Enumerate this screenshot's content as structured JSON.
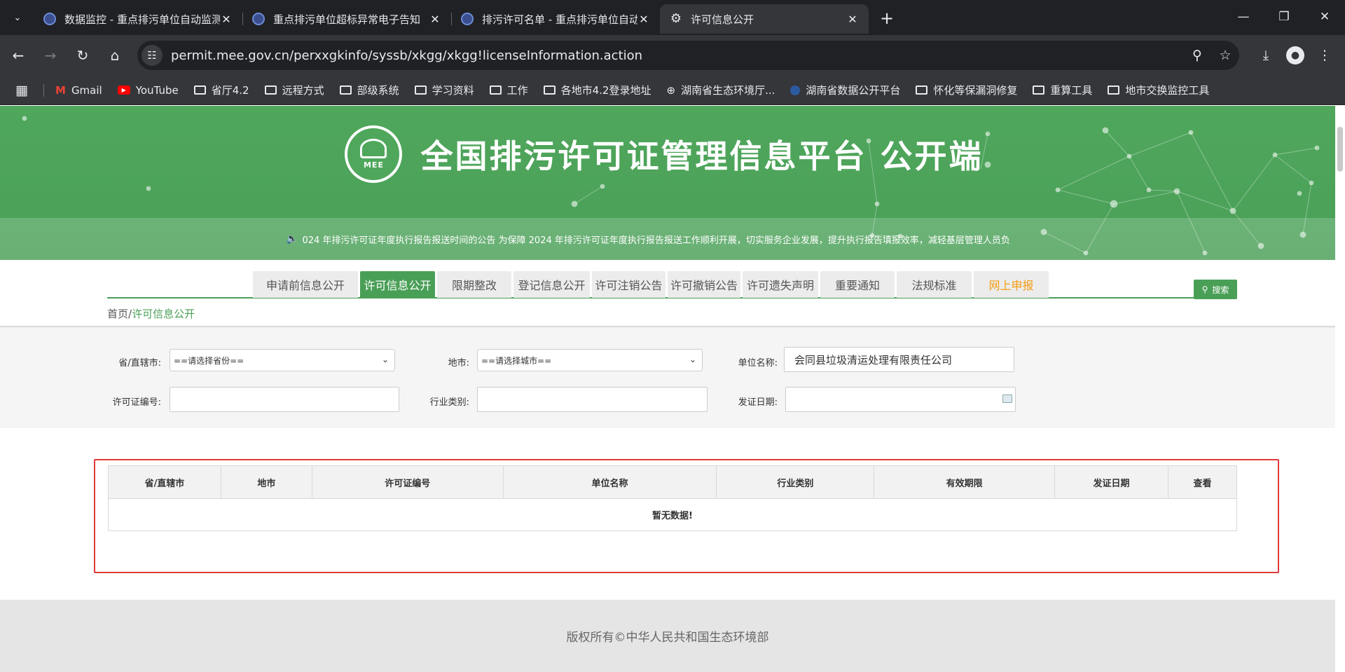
{
  "browser": {
    "tabs": [
      {
        "title": "数据监控 - 重点排污单位自动监测",
        "active": false,
        "icon": "gov-emblem-icon"
      },
      {
        "title": "重点排污单位超标异常电子告知",
        "active": false,
        "icon": "gov-emblem-icon"
      },
      {
        "title": "排污许可名单 - 重点排污单位自动",
        "active": false,
        "icon": "gov-emblem-icon"
      },
      {
        "title": "许可信息公开",
        "active": true,
        "icon": "gear-icon"
      }
    ],
    "url": "permit.mee.gov.cn/perxxgkinfo/syssb/xkgg/xkgg!licenseInformation.action",
    "bookmarks": [
      {
        "label": "Gmail",
        "icon": "gmail-icon"
      },
      {
        "label": "YouTube",
        "icon": "youtube-icon"
      },
      {
        "label": "省厅4.2",
        "icon": "folder-icon"
      },
      {
        "label": "远程方式",
        "icon": "folder-icon"
      },
      {
        "label": "部级系统",
        "icon": "folder-icon"
      },
      {
        "label": "学习资料",
        "icon": "folder-icon"
      },
      {
        "label": "工作",
        "icon": "folder-icon"
      },
      {
        "label": "各地市4.2登录地址",
        "icon": "folder-icon"
      },
      {
        "label": "湖南省生态环境厅...",
        "icon": "globe-icon"
      },
      {
        "label": "湖南省数据公开平台",
        "icon": "gov-emblem-icon"
      },
      {
        "label": "怀化等保漏洞修复",
        "icon": "folder-icon"
      },
      {
        "label": "重算工具",
        "icon": "folder-icon"
      },
      {
        "label": "地市交换监控工具",
        "icon": "folder-icon"
      }
    ]
  },
  "header": {
    "logo_text": "MEE",
    "title": "全国排污许可证管理信息平台 公开端",
    "notice": "024 年排污许可证年度执行报告报送时间的公告 为保障 2024 年排污许可证年度执行报告报送工作顺利开展，切实服务企业发展，提升执行报告填报效率，减轻基层管理人员负"
  },
  "nav": {
    "items": [
      {
        "label": "申请前信息公开",
        "state": "normal"
      },
      {
        "label": "许可信息公开",
        "state": "active"
      },
      {
        "label": "限期整改",
        "state": "normal"
      },
      {
        "label": "登记信息公开",
        "state": "normal"
      },
      {
        "label": "许可注销公告",
        "state": "normal"
      },
      {
        "label": "许可撤销公告",
        "state": "normal"
      },
      {
        "label": "许可遗失声明",
        "state": "normal"
      },
      {
        "label": "重要通知",
        "state": "normal"
      },
      {
        "label": "法规标准",
        "state": "normal"
      },
      {
        "label": "网上申报",
        "state": "highlight"
      }
    ]
  },
  "breadcrumb": {
    "home": "首页",
    "sep": "/",
    "current": "许可信息公开"
  },
  "search": {
    "province_label": "省/直辖市:",
    "province_value": "==请选择省份==",
    "city_label": "地市:",
    "city_value": "==请选择城市==",
    "unit_label": "单位名称:",
    "unit_value": "会同县垃圾清运处理有限责任公司",
    "license_label": "许可证编号:",
    "license_value": "",
    "industry_label": "行业类别:",
    "industry_value": "",
    "date_label": "发证日期:",
    "date_value": "",
    "button_label": "搜索"
  },
  "table": {
    "columns": [
      "省/直辖市",
      "地市",
      "许可证编号",
      "单位名称",
      "行业类别",
      "有效期限",
      "发证日期",
      "查看"
    ],
    "empty_text": "暂无数据!"
  },
  "footer": {
    "text": "版权所有©中华人民共和国生态环境部"
  },
  "colors": {
    "brand_green": "#4a9f57",
    "highlight_orange": "#f39c12",
    "box_red": "#e03a3a"
  }
}
